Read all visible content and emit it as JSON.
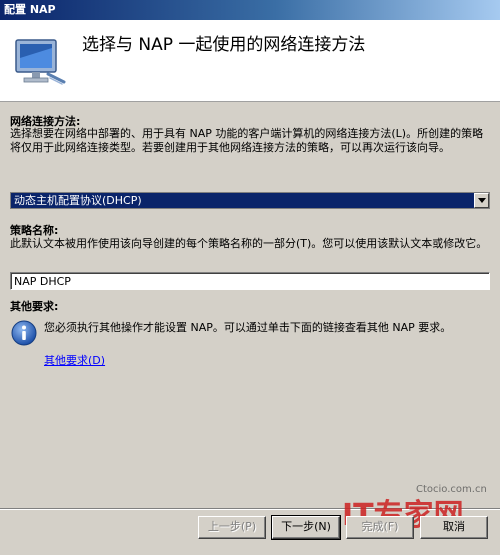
{
  "window": {
    "title": "配置 NAP"
  },
  "header": {
    "title": "选择与 NAP 一起使用的网络连接方法"
  },
  "connection_method": {
    "label": "网络连接方法:",
    "description": "选择想要在网络中部署的、用于具有 NAP 功能的客户端计算机的网络连接方法(L)。所创建的策略将仅用于此网络连接类型。若要创建用于其他网络连接方法的策略，可以再次运行该向导。",
    "selected": "动态主机配置协议(DHCP)"
  },
  "policy_name": {
    "label": "策略名称:",
    "description": "此默认文本被用作使用该向导创建的每个策略名称的一部分(T)。您可以使用该默认文本或修改它。",
    "value": "NAP DHCP"
  },
  "other_requirements": {
    "label": "其他要求:",
    "message": "您必须执行其他操作才能设置 NAP。可以通过单击下面的链接查看其他 NAP 要求。",
    "link": "其他要求(D)"
  },
  "buttons": {
    "prev": "上一步(P)",
    "next": "下一步(N)",
    "finish": "完成(F)",
    "cancel": "取消"
  },
  "watermark": {
    "logo": "IT专家网",
    "site": "Ctocio.com.cn"
  },
  "colors": {
    "selection": "#0a246a",
    "link": "#0000ff",
    "face": "#d4d0c8"
  },
  "icons": [
    "monitor-network-icon",
    "info-icon",
    "dropdown-arrow-icon"
  ]
}
